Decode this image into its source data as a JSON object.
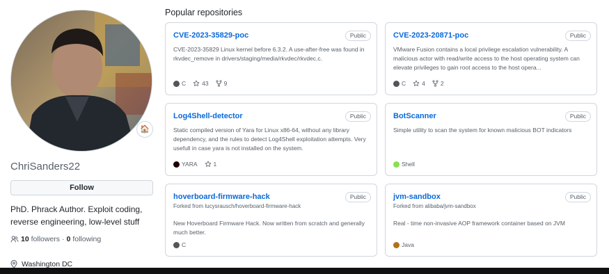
{
  "profile": {
    "username": "ChriSanders22",
    "follow_label": "Follow",
    "bio": "PhD. Phrack Author. Exploit coding, reverse engineering, low-level stuff",
    "followers_count": "10",
    "followers_label": "followers",
    "separator": "·",
    "following_count": "0",
    "following_label": "following",
    "location": "Washington DC",
    "status_emoji": "🏠"
  },
  "section_title": "Popular repositories",
  "repos": [
    {
      "name": "CVE-2023-35829-poc",
      "badge": "Public",
      "forked_from": "",
      "description": "CVE-2023-35829 Linux kernel before 6.3.2. A use-after-free was found in rkvdec_remove in drivers/staging/media/rkvdec/rkvdec.c.",
      "language": "C",
      "lang_color": "#555555",
      "stars": "43",
      "forks": "9"
    },
    {
      "name": "CVE-2023-20871-poc",
      "badge": "Public",
      "forked_from": "",
      "description": "VMware Fusion contains a local privilege escalation vulnerability. A malicious actor with read/write access to the host operating system can elevate privileges to gain root access to the host opera...",
      "language": "C",
      "lang_color": "#555555",
      "stars": "4",
      "forks": "2"
    },
    {
      "name": "Log4Shell-detector",
      "badge": "Public",
      "forked_from": "",
      "description": "Static compiled version of Yara for Linux x86-64, without any library dependency, and the rules to detect Log4Shell exploitation attempts. Very usefull in case yara is not installed on the system.",
      "language": "YARA",
      "lang_color": "#220000",
      "stars": "1",
      "forks": ""
    },
    {
      "name": "BotScanner",
      "badge": "Public",
      "forked_from": "",
      "description": "Simple utility to scan the system for known malicious BOT indicators",
      "language": "Shell",
      "lang_color": "#89e051",
      "stars": "",
      "forks": ""
    },
    {
      "name": "hoverboard-firmware-hack",
      "badge": "Public",
      "forked_from": "Forked from lucysrausch/hoverboard-firmware-hack",
      "description": "New Hoverboard Firmware Hack. Now written from scratch and generally much better.",
      "language": "C",
      "lang_color": "#555555",
      "stars": "",
      "forks": ""
    },
    {
      "name": "jvm-sandbox",
      "badge": "Public",
      "forked_from": "Forked from alibaba/jvm-sandbox",
      "description": "Real - time non-invasive AOP framework container based on JVM",
      "language": "Java",
      "lang_color": "#b07219",
      "stars": "",
      "forks": ""
    }
  ]
}
